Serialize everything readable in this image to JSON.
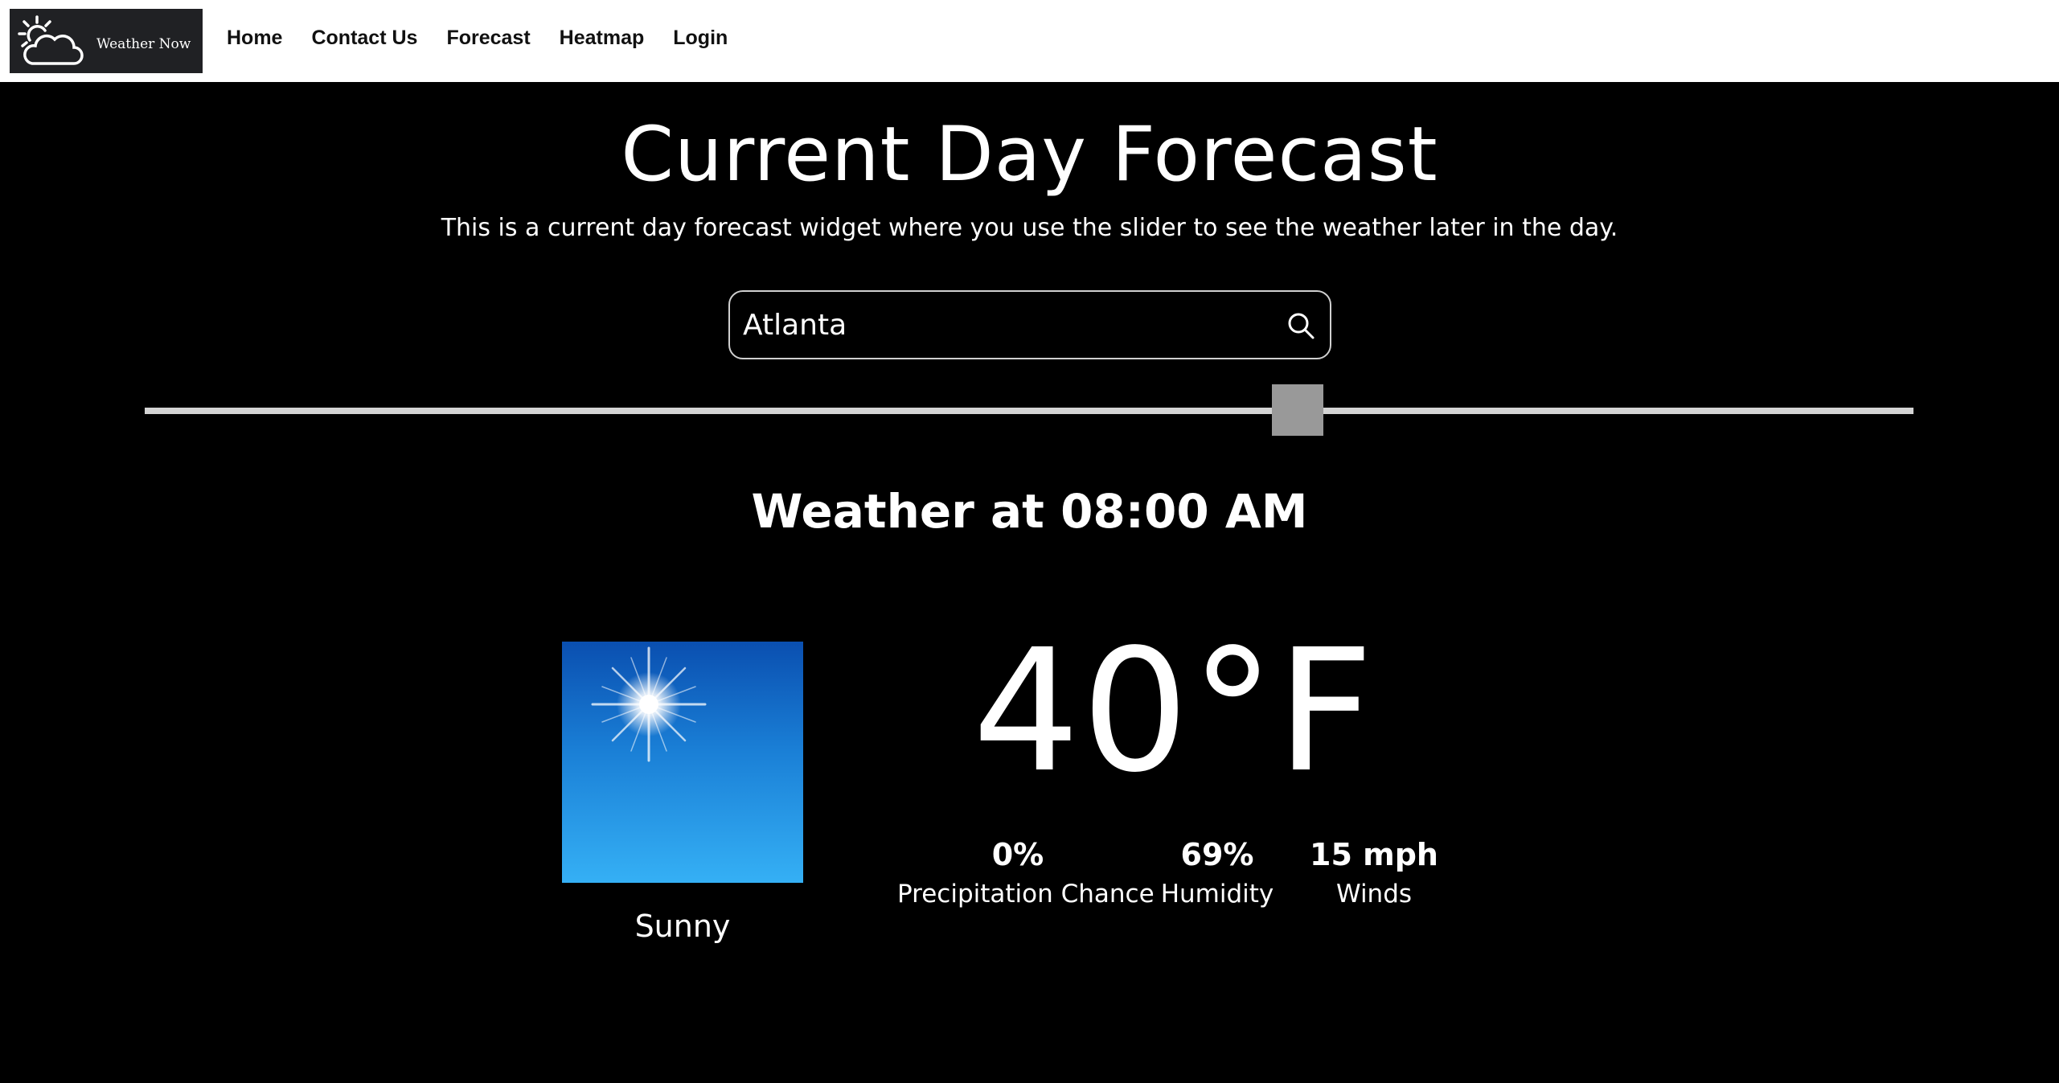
{
  "brand": {
    "name": "Weather Now",
    "logo_icon": "sun-cloud-icon"
  },
  "nav": {
    "items": [
      {
        "label": "Home"
      },
      {
        "label": "Contact Us"
      },
      {
        "label": "Forecast"
      },
      {
        "label": "Heatmap"
      },
      {
        "label": "Login"
      }
    ]
  },
  "page": {
    "title": "Current Day Forecast",
    "subtitle": "This is a current day forecast widget where you use the slider to see the weather later in the day."
  },
  "search": {
    "value": "Atlanta",
    "placeholder": "",
    "icon": "search-icon"
  },
  "slider": {
    "position_fraction": 0.652
  },
  "weather": {
    "heading": "Weather at 08:00 AM",
    "condition": "Sunny",
    "condition_icon": "sunny-sky-icon",
    "temperature": "40°F",
    "stats": {
      "precipitation": {
        "value": "0%",
        "label": "Precipitation Chance"
      },
      "humidity": {
        "value": "69%",
        "label": "Humidity"
      },
      "winds": {
        "value": "15 mph",
        "label": "Winds"
      }
    }
  },
  "colors": {
    "background": "#000000",
    "navbar": "#ffffff",
    "logo_bg": "#202124",
    "slider_track": "#d4d4d4",
    "slider_thumb": "#999999",
    "sky_top": "#0a4fb0",
    "sky_bottom": "#35b0f5"
  }
}
